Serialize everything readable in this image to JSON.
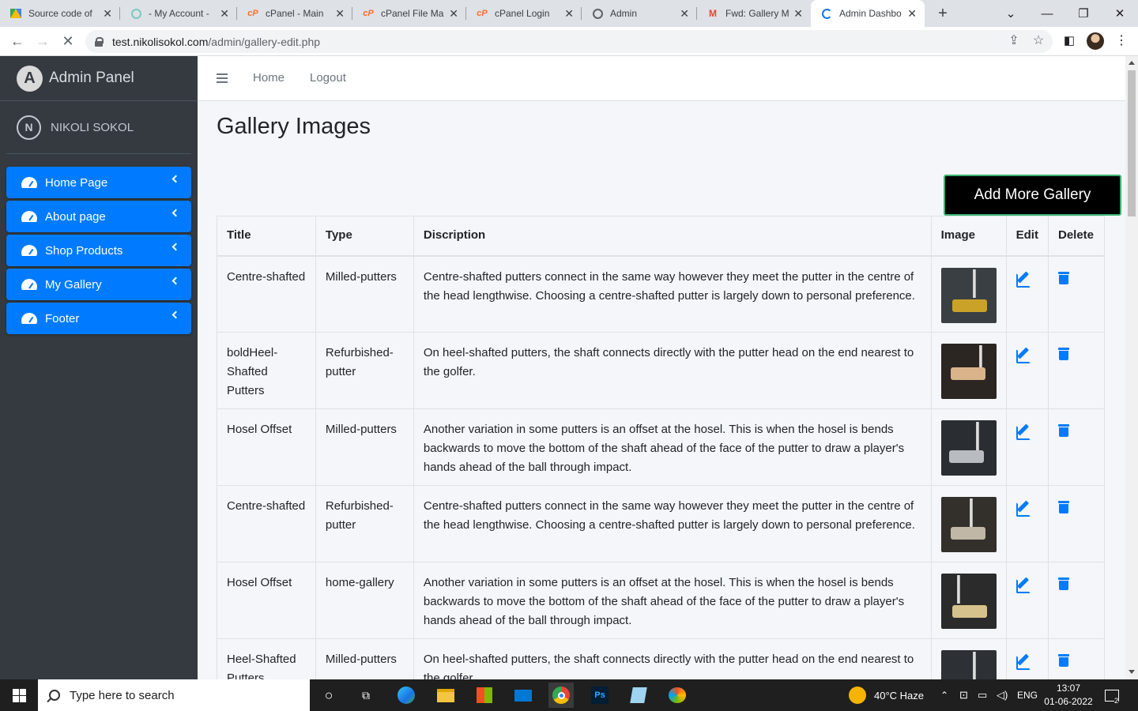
{
  "browser": {
    "tabs": [
      {
        "title": "Source code of",
        "icon": "drive-icon",
        "color": "#fbbc04"
      },
      {
        "title": "- My Account -",
        "icon": "account-icon",
        "color": "#7ec8c0"
      },
      {
        "title": "cPanel - Main",
        "icon": "cpanel-icon",
        "color": "#ff6c2c"
      },
      {
        "title": "cPanel File Man",
        "icon": "cpanel-icon",
        "color": "#ff6c2c"
      },
      {
        "title": "cPanel Login",
        "icon": "cpanel-icon",
        "color": "#ff6c2c"
      },
      {
        "title": "Admin",
        "icon": "globe-icon",
        "color": "#5f6368"
      },
      {
        "title": "Fwd: Gallery M",
        "icon": "gmail-icon",
        "color": "#ea4335"
      },
      {
        "title": "Admin Dashbo",
        "icon": "loading-icon",
        "color": "#1a73e8"
      }
    ],
    "url_host": "test.nikolisokol.com",
    "url_path": "/admin/gallery-edit.php"
  },
  "sidebar": {
    "brand": "Admin Panel",
    "user": "NIKOLI SOKOL",
    "items": [
      {
        "label": "Home Page"
      },
      {
        "label": "About page"
      },
      {
        "label": "Shop Products"
      },
      {
        "label": "My Gallery"
      },
      {
        "label": "Footer"
      }
    ]
  },
  "topnav": {
    "home": "Home",
    "logout": "Logout"
  },
  "main": {
    "title": "Gallery Images",
    "add_button": "Add More Gallery",
    "columns": [
      "Title",
      "Type",
      "Discription",
      "Image",
      "Edit",
      "Delete"
    ],
    "rows": [
      {
        "title": "Centre-shafted",
        "type": "Milled-putters",
        "desc": "Centre-shafted putters connect in the same way however they meet the putter in the centre of the head lengthwise. Choosing a centre-shafted putter is largely down to personal preference."
      },
      {
        "title": "boldHeel-Shafted Putters",
        "type": "Refurbished-putter",
        "desc": "On heel-shafted putters, the shaft connects directly with the putter head on the end nearest to the golfer."
      },
      {
        "title": "Hosel Offset",
        "type": "Milled-putters",
        "desc": "Another variation in some putters is an offset at the hosel. This is when the hosel is bends backwards to move the bottom of the shaft ahead of the face of the putter to draw a player's hands ahead of the ball through impact."
      },
      {
        "title": "Centre-shafted",
        "type": "Refurbished-putter",
        "desc": "Centre-shafted putters connect in the same way however they meet the putter in the centre of the head lengthwise. Choosing a centre-shafted putter is largely down to personal preference."
      },
      {
        "title": "Hosel Offset",
        "type": "home-gallery",
        "desc": "Another variation in some putters is an offset at the hosel. This is when the hosel is bends backwards to move the bottom of the shaft ahead of the face of the putter to draw a player's hands ahead of the ball through impact."
      },
      {
        "title": "Heel-Shafted Putters",
        "type": "Milled-putters",
        "desc": "On heel-shafted putters, the shaft connects directly with the putter head on the end nearest to the golfer"
      }
    ]
  },
  "taskbar": {
    "search_placeholder": "Type here to search",
    "weather": "40°C  Haze",
    "lang": "ENG",
    "time": "13:07",
    "date": "01-06-2022",
    "notifications": "2"
  }
}
